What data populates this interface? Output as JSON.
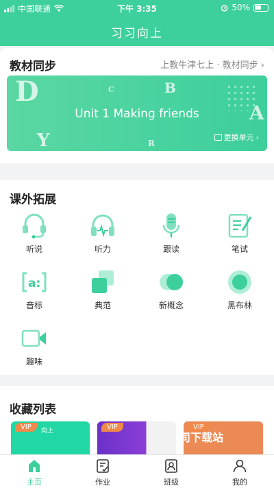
{
  "status": {
    "carrier": "中国联通",
    "time": "下午 3:35",
    "battery": "50%"
  },
  "app_title": "习习向上",
  "textbook_sync": {
    "title": "教材同步",
    "link": "上教牛津七上 · 教材同步",
    "banner_unit": "Unit 1 Making friends",
    "change_unit": "更换单元"
  },
  "extension": {
    "title": "课外拓展",
    "items": [
      {
        "label": "听说",
        "icon": "headset-mic-icon"
      },
      {
        "label": "听力",
        "icon": "headphones-icon"
      },
      {
        "label": "跟读",
        "icon": "microphone-icon"
      },
      {
        "label": "笔试",
        "icon": "paper-pen-icon"
      },
      {
        "label": "音标",
        "icon": "phonetic-icon"
      },
      {
        "label": "典范",
        "icon": "layers-icon"
      },
      {
        "label": "新概念",
        "icon": "overlap-circles-icon"
      },
      {
        "label": "黑布林",
        "icon": "ring-dot-icon"
      },
      {
        "label": "趣味",
        "icon": "video-camera-icon"
      }
    ]
  },
  "favorites": {
    "title": "收藏列表",
    "vip": "VIP",
    "thumb_text": "向上",
    "watermark": "司下载站"
  },
  "tabs": [
    {
      "label": "主页",
      "icon": "home-icon",
      "active": true
    },
    {
      "label": "作业",
      "icon": "homework-icon",
      "active": false
    },
    {
      "label": "班级",
      "icon": "class-icon",
      "active": false
    },
    {
      "label": "我的",
      "icon": "user-icon",
      "active": false
    }
  ],
  "colors": {
    "accent": "#3dcf9c",
    "icon_fill": "#7fe0bf",
    "vip": "#f08a4b"
  }
}
